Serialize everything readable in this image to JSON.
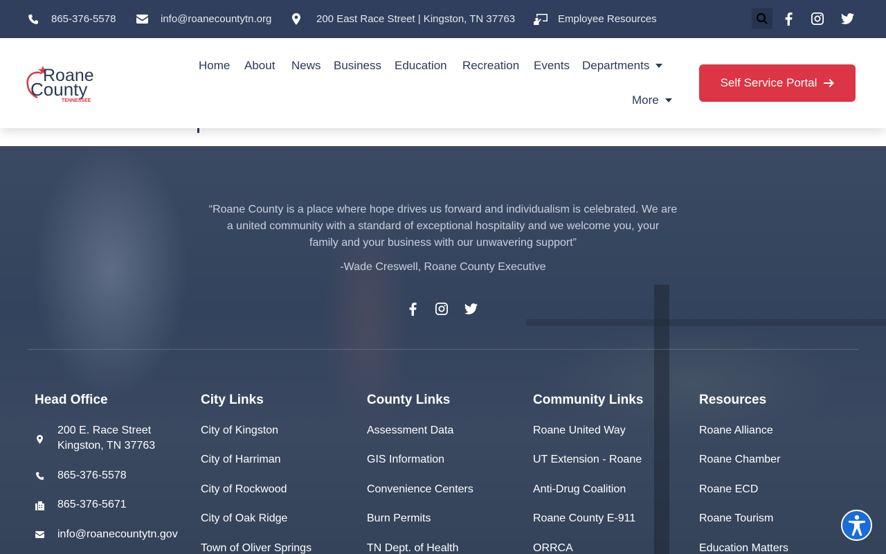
{
  "topbar": {
    "phone": "865-376-5578",
    "email": "info@roanecountytn.org",
    "address": "200 East Race Street | Kingston, TN 37763",
    "employee": "Employee Resources"
  },
  "logo": {
    "line1": "Roane",
    "line2": "County",
    "line3": "TENNESSEE"
  },
  "nav": {
    "home": "Home",
    "about": "About",
    "news": "News",
    "business": "Business",
    "education": "Education",
    "recreation": "Recreation",
    "events": "Events",
    "departments": "Departments",
    "more": "More"
  },
  "portal_button": "Self Service Portal",
  "quote": {
    "line1": "“Roane County is a place where hope drives us forward and individualism is celebrated. We are",
    "line2": "a united community with a standard of exceptional hospitality and we welcome you, your",
    "line3": "family and your business with our unwavering support”",
    "author": "-Wade Creswell, Roane County Executive"
  },
  "footer": {
    "head_office": {
      "title": "Head Office",
      "address1": "200 E. Race Street",
      "address2": "Kingston, TN 37763",
      "phone": "865-376-5578",
      "fax": "865-376-5671",
      "email": "info@roanecountytn.gov"
    },
    "city_links": {
      "title": "City Links",
      "items": [
        "City of Kingston",
        "City of Harriman",
        "City of Rockwood",
        "City of Oak Ridge",
        "Town of Oliver Springs"
      ]
    },
    "county_links": {
      "title": "County Links",
      "items": [
        "Assessment Data",
        "GIS Information",
        "Convenience Centers",
        "Burn Permits",
        "TN Dept. of Health"
      ]
    },
    "community_links": {
      "title": "Community Links",
      "items": [
        "Roane United Way",
        "UT Extension - Roane",
        "Anti-Drug Coalition",
        "Roane County E-911",
        "ORRCA"
      ]
    },
    "resources": {
      "title": "Resources",
      "items": [
        "Roane Alliance",
        "Roane Chamber",
        "Roane ECD",
        "Roane Tourism",
        "Education Matters"
      ]
    }
  },
  "colors": {
    "topbar": "#2f3f5d",
    "accent": "#dc3545",
    "navy": "#2b3a55"
  },
  "icons": [
    "phone-icon",
    "mail-icon",
    "map-pin-icon",
    "employee-icon",
    "search-icon",
    "facebook-icon",
    "instagram-icon",
    "twitter-icon",
    "arrow-right-icon",
    "fax-icon",
    "accessibility-icon"
  ]
}
